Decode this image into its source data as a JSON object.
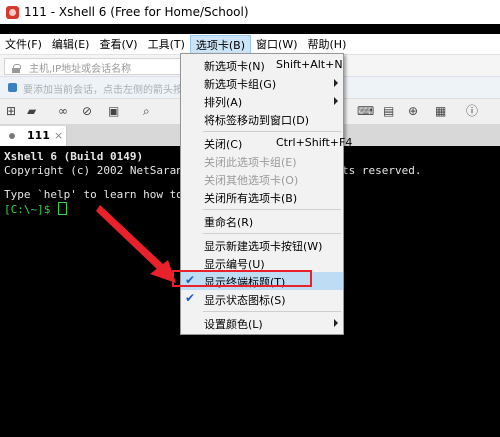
{
  "window": {
    "title": "111 - Xshell 6 (Free for Home/School)"
  },
  "menubar": [
    "文件(F)",
    "编辑(E)",
    "查看(V)",
    "工具(T)",
    "选项卡(B)",
    "窗口(W)",
    "帮助(H)"
  ],
  "address": {
    "placeholder": "主机,IP地址或会话名称"
  },
  "hint": {
    "text": "要添加当前会话，点击左侧的箭头按钮。"
  },
  "tab": {
    "label": "111",
    "close": "×"
  },
  "terminal": {
    "line1": "Xshell 6 (Build 0149)",
    "line2": "Copyright (c) 2002 NetSaran",
    "line2b": "ts reserved.",
    "line3": "Type `help' to learn how to",
    "prompt": "[C:\\~]$ "
  },
  "dropdown": {
    "items": [
      {
        "label": "新选项卡(N)",
        "shortcut": "Shift+Alt+N"
      },
      {
        "label": "新选项卡组(G)",
        "submenu": true
      },
      {
        "label": "排列(A)",
        "submenu": true
      },
      {
        "label": "将标签移动到窗口(D)"
      },
      {
        "label": "关闭(C)",
        "shortcut": "Ctrl+Shift+F4"
      },
      {
        "label": "关闭此选项卡组(E)",
        "disabled": true
      },
      {
        "label": "关闭其他选项卡(O)",
        "disabled": true
      },
      {
        "label": "关闭所有选项卡(B)"
      },
      {
        "label": "重命名(R)"
      },
      {
        "label": "显示新建选项卡按钮(W)"
      },
      {
        "label": "显示编号(U)"
      },
      {
        "label": "显示终端标题(T)",
        "checked": true,
        "highlighted": true
      },
      {
        "label": "显示状态图标(S)",
        "checked": true
      },
      {
        "label": "设置颜色(L)",
        "submenu": true
      }
    ]
  },
  "check_mark": "✔",
  "colors": {
    "highlight_box": "#e8212b",
    "annotation_arrow": "#e8212b",
    "prompt": "#38d14a"
  }
}
